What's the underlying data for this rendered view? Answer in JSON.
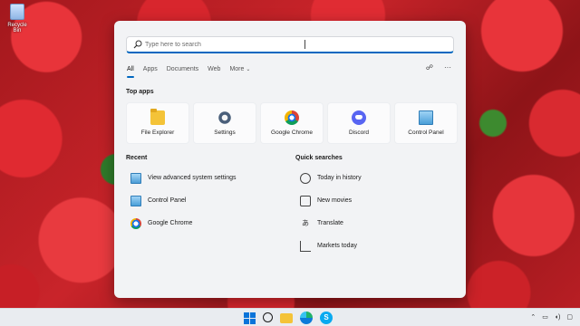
{
  "desktop": {
    "recycle_bin_label": "Recycle Bin"
  },
  "search": {
    "placeholder": "Type here to search"
  },
  "tabs": [
    {
      "label": "All"
    },
    {
      "label": "Apps"
    },
    {
      "label": "Documents"
    },
    {
      "label": "Web"
    },
    {
      "label": "More"
    }
  ],
  "top_apps": {
    "title": "Top apps",
    "items": [
      {
        "label": "File Explorer",
        "icon": "folder-icon"
      },
      {
        "label": "Settings",
        "icon": "gear-icon"
      },
      {
        "label": "Google Chrome",
        "icon": "chrome-icon"
      },
      {
        "label": "Discord",
        "icon": "discord-icon"
      },
      {
        "label": "Control Panel",
        "icon": "control-panel-icon"
      }
    ]
  },
  "recent": {
    "title": "Recent",
    "items": [
      {
        "label": "View advanced system settings",
        "icon": "monitor-icon"
      },
      {
        "label": "Control Panel",
        "icon": "control-panel-icon"
      },
      {
        "label": "Google Chrome",
        "icon": "chrome-icon"
      }
    ]
  },
  "quick_searches": {
    "title": "Quick searches",
    "items": [
      {
        "label": "Today in history",
        "icon": "clock-icon"
      },
      {
        "label": "New movies",
        "icon": "film-icon"
      },
      {
        "label": "Translate",
        "icon": "translate-icon"
      },
      {
        "label": "Markets today",
        "icon": "chart-icon"
      }
    ]
  },
  "colors": {
    "accent": "#0067c0",
    "panel_bg": "#f2f3f5",
    "taskbar_bg": "#e9ecf0"
  }
}
